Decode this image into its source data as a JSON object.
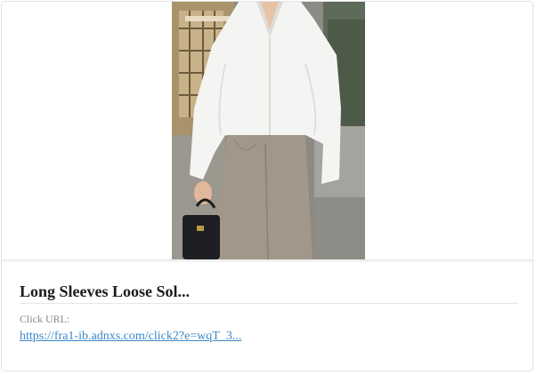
{
  "card": {
    "title": "Long Sleeves Loose Sol...",
    "click_label": "Click URL:",
    "click_url_text": "https://fra1-ib.adnxs.com/click2?e=wqT_3..."
  },
  "colors": {
    "link": "#3a87c7",
    "title": "#1b1b1b",
    "label": "#8a8a8a"
  },
  "image": {
    "alt": "product-photo"
  }
}
